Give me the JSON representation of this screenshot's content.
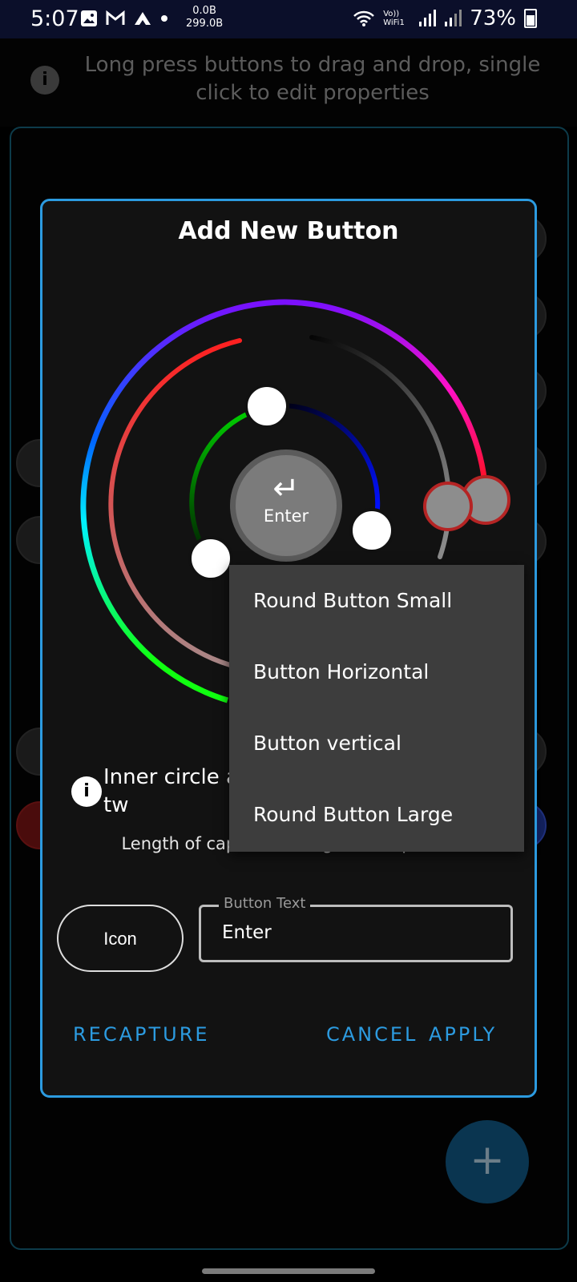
{
  "status_bar": {
    "time": "5:07",
    "net_up": "0.0B",
    "net_down": "299.0B",
    "wifi_label": "Vo)) WiFi1",
    "battery": "73%"
  },
  "hint": {
    "text": "Long press buttons to drag and drop, single click to edit properties"
  },
  "dialog": {
    "title": "Add New Button",
    "preview": {
      "icon": "↵",
      "label": "Enter"
    },
    "info_text": "Inner circle and outer tw",
    "ir_length": "Length of captured IR signal : 32 pulses",
    "icon_button": "Icon",
    "button_text": {
      "label": "Button Text",
      "value": "Enter"
    },
    "actions": {
      "recapture": "RECAPTURE",
      "cancel": "CANCEL",
      "apply": "APPLY"
    }
  },
  "dropdown": {
    "items": [
      "Round Button Small",
      "Button Horizontal",
      "Button vertical",
      "Round Button Large"
    ]
  },
  "fab": {
    "icon": "+"
  },
  "colors": {
    "accent": "#2c9be0",
    "dialog_bg": "#121212",
    "menu_bg": "#3d3d3d",
    "knob_border": "#b52424"
  }
}
